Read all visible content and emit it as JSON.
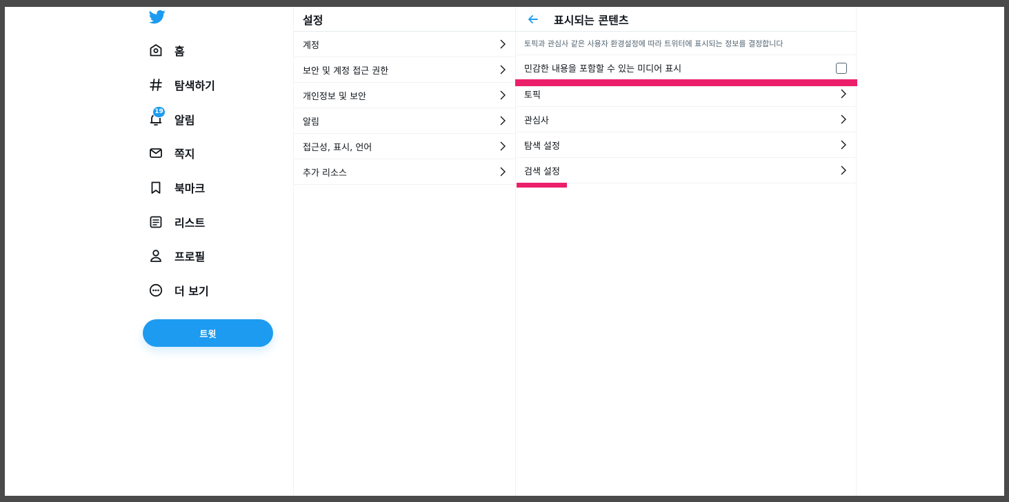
{
  "nav": {
    "logo_icon": "twitter-bird-icon",
    "items": [
      {
        "label": "홈",
        "icon": "home-icon"
      },
      {
        "label": "탐색하기",
        "icon": "hashtag-icon"
      },
      {
        "label": "알림",
        "icon": "bell-icon",
        "badge": "19"
      },
      {
        "label": "쪽지",
        "icon": "mail-icon"
      },
      {
        "label": "북마크",
        "icon": "bookmark-icon"
      },
      {
        "label": "리스트",
        "icon": "list-icon"
      },
      {
        "label": "프로필",
        "icon": "profile-icon"
      },
      {
        "label": "더 보기",
        "icon": "more-icon"
      }
    ],
    "tweet_button": "트윗"
  },
  "settings": {
    "title": "설정",
    "items": [
      {
        "label": "계정"
      },
      {
        "label": "보안 및 계정 접근 권한"
      },
      {
        "label": "개인정보 및 보안"
      },
      {
        "label": "알림"
      },
      {
        "label": "접근성, 표시, 언어"
      },
      {
        "label": "추가 리소스"
      }
    ]
  },
  "content": {
    "title": "표시되는 콘텐츠",
    "description": "토픽과 관심사 같은 사용자 환경설정에 따라 트위터에 표시되는 정보를 결정합니다",
    "sensitive_media": {
      "label": "민감한 내용을 포함할 수 있는 미디어 표시",
      "checked": false
    },
    "items": [
      {
        "label": "토픽"
      },
      {
        "label": "관심사"
      },
      {
        "label": "탐색 설정"
      },
      {
        "label": "검색 설정"
      }
    ]
  },
  "colors": {
    "accent": "#1d9bf0",
    "highlight": "#ec1f6b"
  }
}
